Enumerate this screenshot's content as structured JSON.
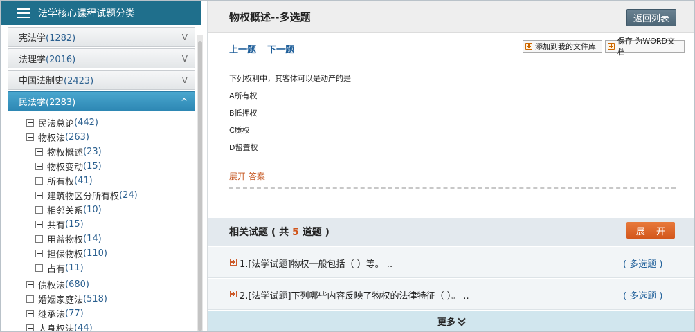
{
  "sidebar": {
    "title": "法学核心课程试题分类",
    "categories": [
      {
        "name": "宪法学",
        "count": "(1282)",
        "chev": "V"
      },
      {
        "name": "法理学",
        "count": "(2016)",
        "chev": "V"
      },
      {
        "name": "中国法制史",
        "count": "(2423)",
        "chev": "V"
      },
      {
        "name": "民法学",
        "count": "(2283)",
        "chev": "^"
      }
    ],
    "tree": [
      {
        "name": "民法总论",
        "count": "(442)"
      },
      {
        "name": "物权法",
        "count": "(263)"
      },
      {
        "name": "物权概述",
        "count": "(23)"
      },
      {
        "name": "物权变动",
        "count": "(15)"
      },
      {
        "name": "所有权",
        "count": "(41)"
      },
      {
        "name": "建筑物区分所有权",
        "count": "(24)"
      },
      {
        "name": "相邻关系",
        "count": "(10)"
      },
      {
        "name": "共有",
        "count": "(15)"
      },
      {
        "name": "用益物权",
        "count": "(14)"
      },
      {
        "name": "担保物权",
        "count": "(110)"
      },
      {
        "name": "占有",
        "count": "(11)"
      },
      {
        "name": "债权法",
        "count": "(680)"
      },
      {
        "name": "婚姻家庭法",
        "count": "(518)"
      },
      {
        "name": "继承法",
        "count": "(77)"
      },
      {
        "name": "人身权法",
        "count": "(44)"
      }
    ]
  },
  "main": {
    "title": "物权概述--多选题",
    "back_label": "返回列表",
    "prev_label": "上一题",
    "next_label": "下一题",
    "add_label": "添加到我的文件库",
    "save_label": "保存 为WORD文档",
    "question": "下列权利中，其客体可以是动产的是",
    "options": [
      "A所有权",
      "B抵押权",
      "C质权",
      "D留置权"
    ],
    "expand_answer_label": "展开 答案",
    "related": {
      "title_prefix": "相关试题 ( 共 ",
      "count": "5",
      "title_suffix": " 道题 )",
      "expand_label": "展 开",
      "items": [
        {
          "text": "1.[法学试题]物权一般包括（  ）等。 ..",
          "type": "( 多选题 )"
        },
        {
          "text": "2.[法学试题]下列哪些内容反映了物权的法律特征（  ）。 ..",
          "type": "( 多选题 )"
        }
      ],
      "more_label": "更多"
    }
  }
}
